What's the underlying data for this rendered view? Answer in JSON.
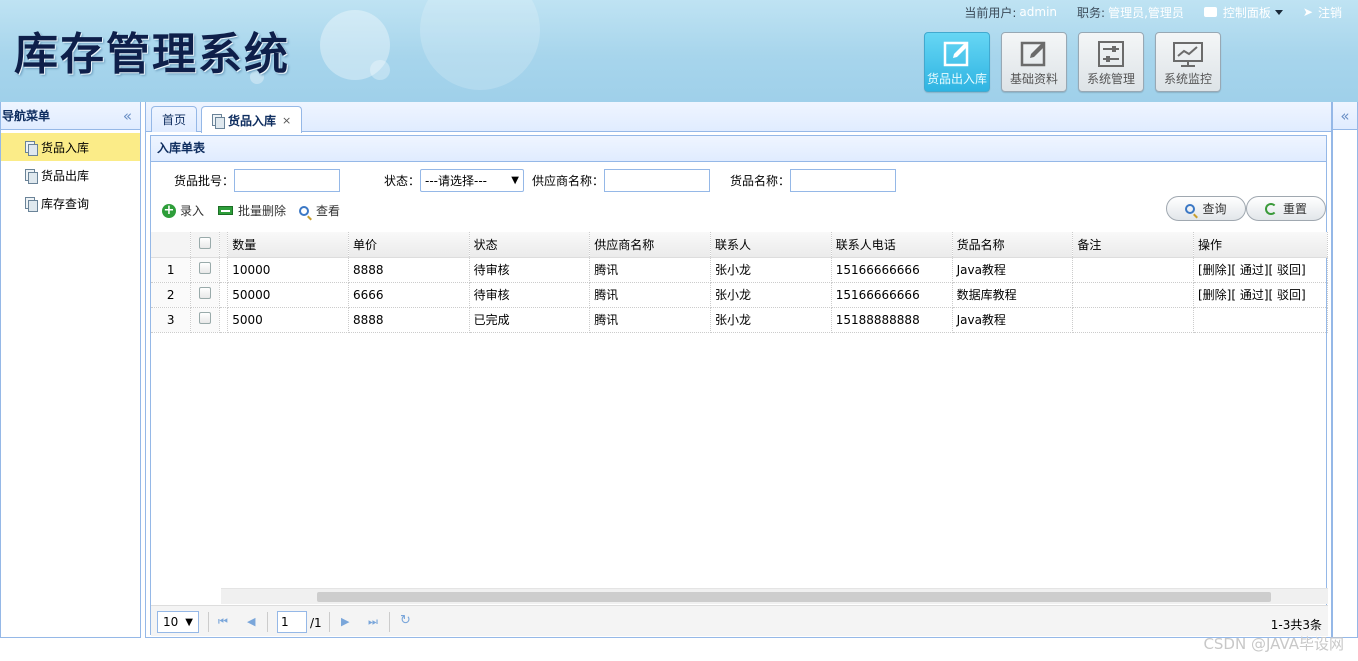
{
  "app": {
    "title": "库存管理系统"
  },
  "userbar": {
    "user_label": "当前用户:",
    "user_value": "admin",
    "role_label": "职务:",
    "role_value": "管理员,管理员",
    "control_panel": "控制面板",
    "logout": "注销"
  },
  "modules": [
    {
      "label": "货品出入库",
      "icon": "edit-icon",
      "active": true
    },
    {
      "label": "基础资料",
      "icon": "edit-icon",
      "active": false
    },
    {
      "label": "系统管理",
      "icon": "sliders-icon",
      "active": false
    },
    {
      "label": "系统监控",
      "icon": "monitor-icon",
      "active": false
    }
  ],
  "nav": {
    "title": "导航菜单",
    "items": [
      {
        "label": "货品入库",
        "selected": true
      },
      {
        "label": "货品出库",
        "selected": false
      },
      {
        "label": "库存查询",
        "selected": false
      }
    ]
  },
  "tabs": [
    {
      "label": "首页"
    },
    {
      "label": "货品入库",
      "closable": true
    }
  ],
  "panel": {
    "title": "入库单表"
  },
  "filters": {
    "batch_label": "货品批号：",
    "batch_value": "",
    "status_label": "状态：",
    "status_value": "---请选择---",
    "supplier_label": "供应商名称：",
    "supplier_value": "",
    "goods_label": "货品名称：",
    "goods_value": ""
  },
  "toolbar": {
    "add": "录入",
    "batch_delete": "批量删除",
    "view": "查看",
    "query": "查询",
    "reset": "重置"
  },
  "grid": {
    "columns": [
      "数量",
      "单价",
      "状态",
      "供应商名称",
      "联系人",
      "联系人电话",
      "货品名称",
      "备注",
      "操作"
    ],
    "rows": [
      {
        "num": "1",
        "qty": "10000",
        "price": "8888",
        "status": "待审核",
        "supplier": "腾讯",
        "contact": "张小龙",
        "phone": "15166666666",
        "goods": "Java教程",
        "remark": "",
        "ops": "[删除][ 通过][ 驳回]"
      },
      {
        "num": "2",
        "qty": "50000",
        "price": "6666",
        "status": "待审核",
        "supplier": "腾讯",
        "contact": "张小龙",
        "phone": "15166666666",
        "goods": "数据库教程",
        "remark": "",
        "ops": "[删除][ 通过][ 驳回]"
      },
      {
        "num": "3",
        "qty": "5000",
        "price": "8888",
        "status": "已完成",
        "supplier": "腾讯",
        "contact": "张小龙",
        "phone": "15188888888",
        "goods": "Java教程",
        "remark": "",
        "ops": ""
      }
    ]
  },
  "pager": {
    "page_size": "10",
    "page": "1",
    "total_pages": "/1",
    "info": "1-3共3条"
  },
  "watermark": "CSDN @JAVA毕设网"
}
